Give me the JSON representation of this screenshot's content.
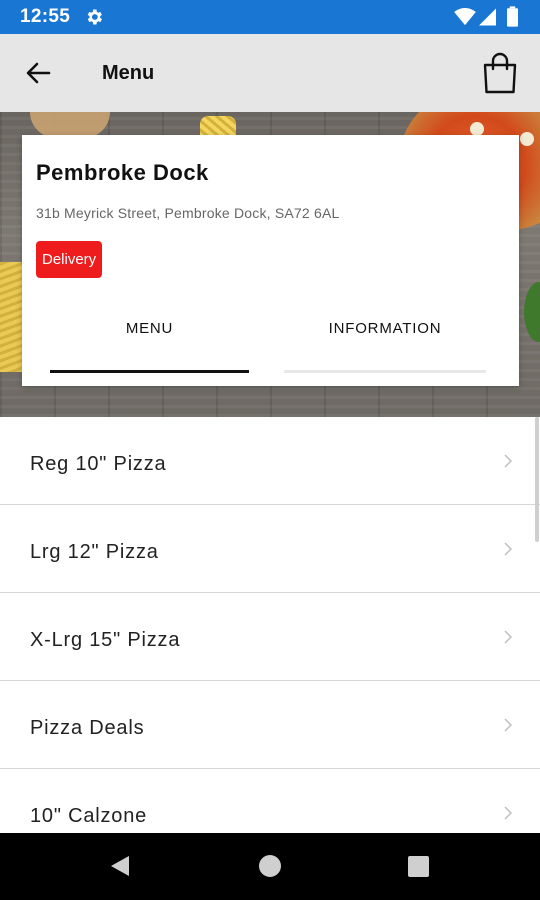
{
  "status_bar": {
    "time": "12:55",
    "icons": [
      "gear-icon",
      "wifi-icon",
      "signal-icon",
      "battery-icon"
    ],
    "color": "#1976d2"
  },
  "app_bar": {
    "title": "Menu",
    "back_icon": "arrow-left-icon",
    "bag_icon": "shopping-bag-icon"
  },
  "store": {
    "name": "Pembroke Dock",
    "address": "31b Meyrick Street, Pembroke Dock, SA72 6AL",
    "badge": "Delivery",
    "badge_color": "#ee1c1c"
  },
  "tabs": [
    {
      "label": "MENU",
      "active": true
    },
    {
      "label": "INFORMATION",
      "active": false
    }
  ],
  "categories": [
    {
      "label": "Reg 10\" Pizza"
    },
    {
      "label": "Lrg 12\" Pizza"
    },
    {
      "label": "X-Lrg 15\" Pizza"
    },
    {
      "label": "Pizza Deals"
    },
    {
      "label": "10\" Calzone"
    }
  ],
  "nav_bar": {
    "icons": [
      "back-triangle-icon",
      "home-circle-icon",
      "recents-square-icon"
    ]
  }
}
